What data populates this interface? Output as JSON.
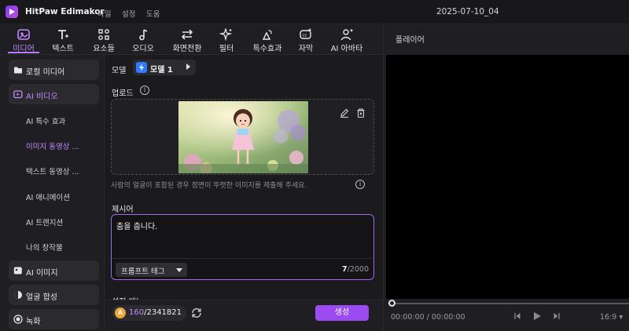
{
  "app": {
    "title": "HitPaw Edimakor",
    "menus": [
      "파일",
      "설정",
      "도움"
    ],
    "document_title": "2025-07-10_04"
  },
  "tools": [
    {
      "label": "미디어",
      "icon": "media-icon",
      "active": true
    },
    {
      "label": "텍스트",
      "icon": "text-icon"
    },
    {
      "label": "요소들",
      "icon": "elements-icon"
    },
    {
      "label": "오디오",
      "icon": "audio-icon"
    },
    {
      "label": "화면전환",
      "icon": "transition-icon"
    },
    {
      "label": "필터",
      "icon": "filter-icon"
    },
    {
      "label": "특수효과",
      "icon": "effects-icon"
    },
    {
      "label": "자막",
      "icon": "subtitle-icon"
    },
    {
      "label": "AI 아바타",
      "icon": "ai-avatar-icon"
    }
  ],
  "sidebar": {
    "local_media": "로컬 미디어",
    "ai_video": "AI 비디오",
    "ai_video_items": [
      "AI 특수 효과",
      "이미지 동영상 ...",
      "텍스트 동영상 ...",
      "AI 애니메이션",
      "AI 트랜지션",
      "나의 창작물"
    ],
    "ai_image": "AI 이미지",
    "face_swap": "얼굴 합성",
    "record": "녹화"
  },
  "panel": {
    "model_label": "모델",
    "model_value": "모델 1",
    "upload_label": "업로드",
    "upload_hint": "사람의 얼굴이 포함된 경우 정면이 뚜렷한 이미지를 제출해 주세요.",
    "prompt_label": "제시어",
    "prompt_text": "춤을 춥니다.",
    "prompt_tag_button": "프롬프트 태그",
    "char_count": "7",
    "char_max": "/2000",
    "settings_label": "설정 메뉴",
    "credits_used": "160",
    "credits_total": "/2341821",
    "generate_button": "생성"
  },
  "player": {
    "title": "플레이어",
    "timecode": "00:00:00 / 00:00:00",
    "aspect_ratio": "16:9",
    "progress": 0
  },
  "colors": {
    "accent": "#b57cff",
    "generate": "#9b4bf0",
    "background": "#1b1b1e"
  }
}
